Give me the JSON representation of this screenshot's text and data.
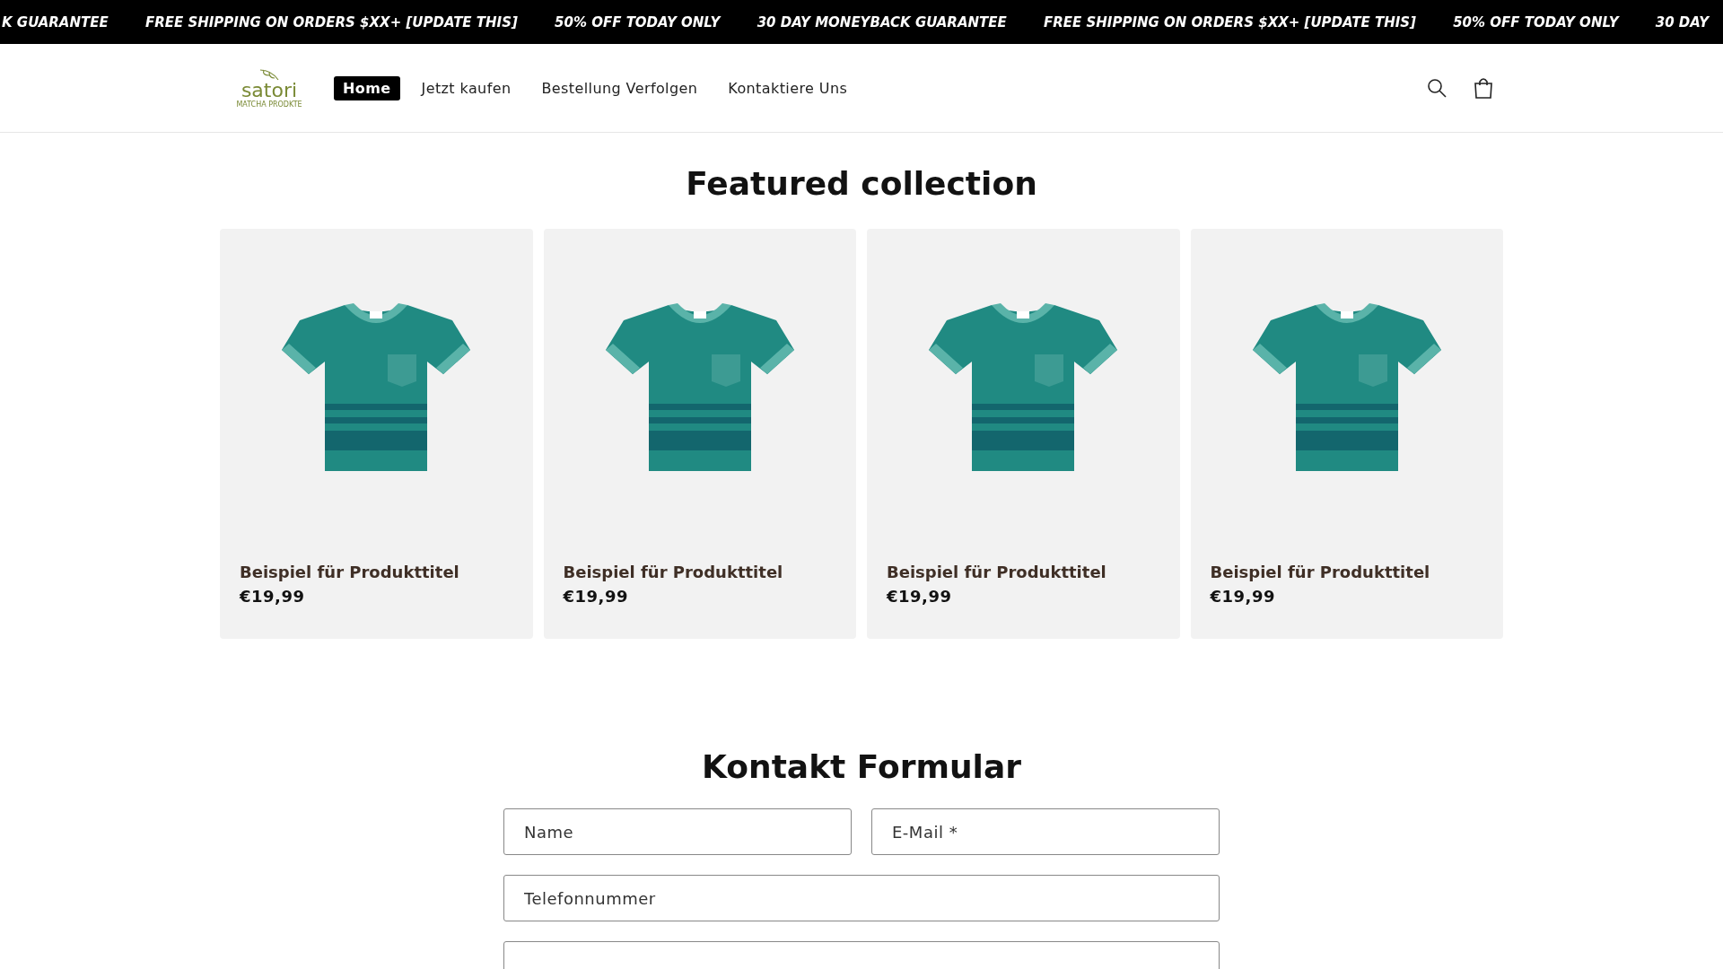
{
  "announcement_bar": {
    "messages": [
      "K GUARANTEE",
      "FREE SHIPPING ON ORDERS $XX+ [UPDATE THIS]",
      "50% OFF TODAY ONLY",
      "30 DAY MONEYBACK GUARANTEE",
      "FREE SHIPPING ON ORDERS $XX+ [UPDATE THIS]",
      "50% OFF TODAY ONLY",
      "30 DAY"
    ]
  },
  "header": {
    "logo": {
      "name": "satori",
      "tagline": "MATCHA PRODKTE"
    },
    "nav": [
      {
        "label": "Home",
        "selected": true
      },
      {
        "label": "Jetzt kaufen",
        "selected": false
      },
      {
        "label": "Bestellung Verfolgen",
        "selected": false
      },
      {
        "label": "Kontaktiere Uns",
        "selected": false
      }
    ]
  },
  "featured_collection": {
    "title": "Featured collection",
    "products": [
      {
        "title": "Beispiel für Produkttitel",
        "price": "€19,99"
      },
      {
        "title": "Beispiel für Produkttitel",
        "price": "€19,99"
      },
      {
        "title": "Beispiel für Produkttitel",
        "price": "€19,99"
      },
      {
        "title": "Beispiel für Produkttitel",
        "price": "€19,99"
      }
    ]
  },
  "contact_form": {
    "title": "Kontakt Formular",
    "fields": [
      {
        "kind": "text",
        "placeholder": "Name"
      },
      {
        "kind": "email",
        "placeholder": "E-Mail *"
      },
      {
        "kind": "tel",
        "placeholder": "Telefonnummer"
      },
      {
        "kind": "textarea"
      }
    ]
  }
}
